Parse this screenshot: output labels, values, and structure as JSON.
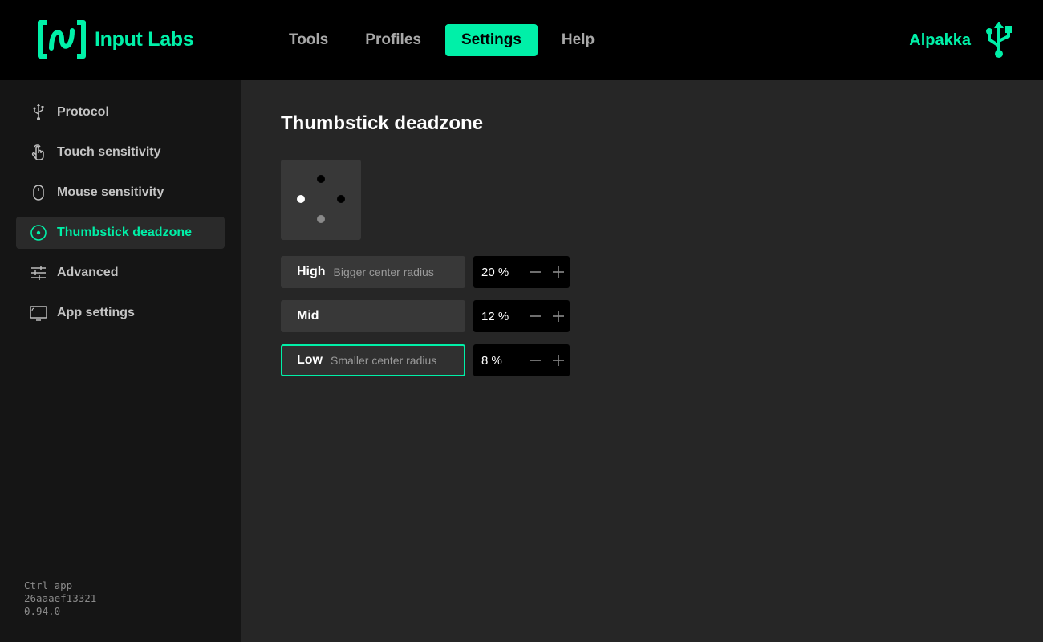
{
  "header": {
    "brand": "Input Labs",
    "brand_icon": "input-labs-logo-icon",
    "nav": [
      {
        "label": "Tools",
        "active": false
      },
      {
        "label": "Profiles",
        "active": false
      },
      {
        "label": "Settings",
        "active": true
      },
      {
        "label": "Help",
        "active": false
      }
    ],
    "device_name": "Alpakka",
    "device_icon": "usb-icon"
  },
  "sidebar": {
    "items": [
      {
        "label": "Protocol",
        "icon": "usb-icon",
        "active": false
      },
      {
        "label": "Touch sensitivity",
        "icon": "touch-icon",
        "active": false
      },
      {
        "label": "Mouse sensitivity",
        "icon": "mouse-icon",
        "active": false
      },
      {
        "label": "Thumbstick deadzone",
        "icon": "thumbstick-icon",
        "active": true
      },
      {
        "label": "Advanced",
        "icon": "sliders-icon",
        "active": false
      },
      {
        "label": "App settings",
        "icon": "monitor-icon",
        "active": false
      }
    ],
    "version": {
      "app": "Ctrl app",
      "commit": "26aaaef13321",
      "number": "0.94.0"
    }
  },
  "main": {
    "title": "Thumbstick deadzone",
    "options": [
      {
        "label": "High",
        "description": "Bigger center radius",
        "value": "20 %",
        "selected": false
      },
      {
        "label": "Mid",
        "description": "",
        "value": "12 %",
        "selected": false
      },
      {
        "label": "Low",
        "description": "Smaller center radius",
        "value": "8 %",
        "selected": true
      }
    ]
  },
  "colors": {
    "accent": "#00f0a8",
    "header_bg": "#000000",
    "sidebar_bg": "#151515",
    "main_bg": "#262626",
    "panel_bg": "#383838"
  }
}
